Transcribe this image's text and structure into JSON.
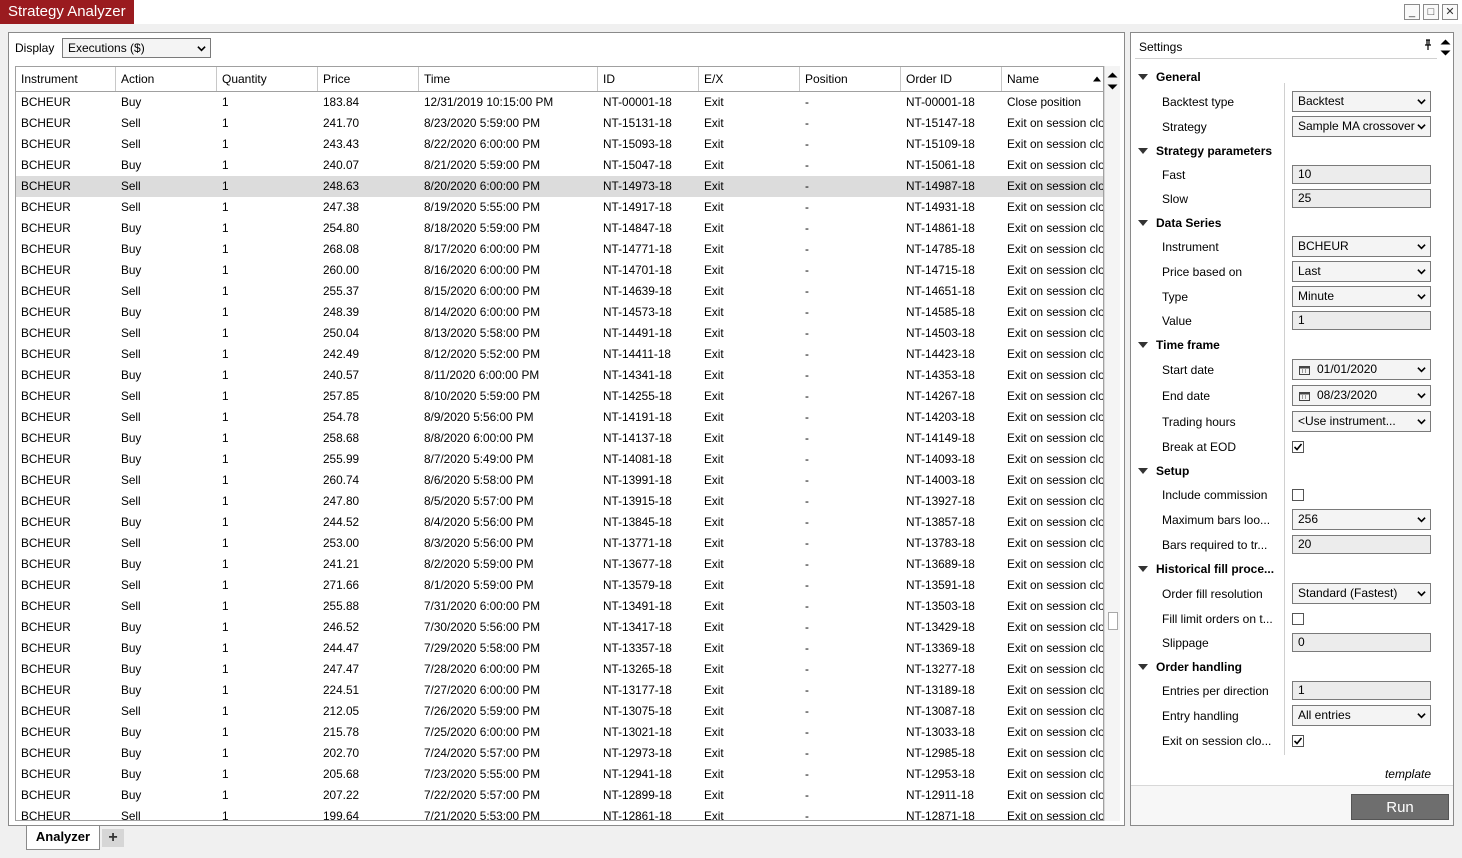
{
  "window": {
    "title": "Strategy Analyzer",
    "accent_color": "#9a1b1f",
    "buttons": {
      "minimize": "_",
      "maximize": "□",
      "close": "✕"
    }
  },
  "display": {
    "label": "Display",
    "selected": "Executions ($)"
  },
  "grid": {
    "columns": [
      "Instrument",
      "Action",
      "Quantity",
      "Price",
      "Time",
      "ID",
      "E/X",
      "Position",
      "Order ID",
      "Name"
    ],
    "rows": [
      [
        "BCHEUR",
        "Buy",
        "1",
        "183.84",
        "12/31/2019 10:15:00 PM",
        "NT-00001-18",
        "Exit",
        "-",
        "NT-00001-18",
        "Close position"
      ],
      [
        "BCHEUR",
        "Sell",
        "1",
        "241.70",
        "8/23/2020 5:59:00 PM",
        "NT-15131-18",
        "Exit",
        "-",
        "NT-15147-18",
        "Exit on session close"
      ],
      [
        "BCHEUR",
        "Sell",
        "1",
        "243.43",
        "8/22/2020 6:00:00 PM",
        "NT-15093-18",
        "Exit",
        "-",
        "NT-15109-18",
        "Exit on session close"
      ],
      [
        "BCHEUR",
        "Buy",
        "1",
        "240.07",
        "8/21/2020 5:59:00 PM",
        "NT-15047-18",
        "Exit",
        "-",
        "NT-15061-18",
        "Exit on session close"
      ],
      [
        "BCHEUR",
        "Sell",
        "1",
        "248.63",
        "8/20/2020 6:00:00 PM",
        "NT-14973-18",
        "Exit",
        "-",
        "NT-14987-18",
        "Exit on session close"
      ],
      [
        "BCHEUR",
        "Sell",
        "1",
        "247.38",
        "8/19/2020 5:55:00 PM",
        "NT-14917-18",
        "Exit",
        "-",
        "NT-14931-18",
        "Exit on session close"
      ],
      [
        "BCHEUR",
        "Buy",
        "1",
        "254.80",
        "8/18/2020 5:59:00 PM",
        "NT-14847-18",
        "Exit",
        "-",
        "NT-14861-18",
        "Exit on session close"
      ],
      [
        "BCHEUR",
        "Buy",
        "1",
        "268.08",
        "8/17/2020 6:00:00 PM",
        "NT-14771-18",
        "Exit",
        "-",
        "NT-14785-18",
        "Exit on session close"
      ],
      [
        "BCHEUR",
        "Buy",
        "1",
        "260.00",
        "8/16/2020 6:00:00 PM",
        "NT-14701-18",
        "Exit",
        "-",
        "NT-14715-18",
        "Exit on session close"
      ],
      [
        "BCHEUR",
        "Sell",
        "1",
        "255.37",
        "8/15/2020 6:00:00 PM",
        "NT-14639-18",
        "Exit",
        "-",
        "NT-14651-18",
        "Exit on session close"
      ],
      [
        "BCHEUR",
        "Buy",
        "1",
        "248.39",
        "8/14/2020 6:00:00 PM",
        "NT-14573-18",
        "Exit",
        "-",
        "NT-14585-18",
        "Exit on session close"
      ],
      [
        "BCHEUR",
        "Sell",
        "1",
        "250.04",
        "8/13/2020 5:58:00 PM",
        "NT-14491-18",
        "Exit",
        "-",
        "NT-14503-18",
        "Exit on session close"
      ],
      [
        "BCHEUR",
        "Sell",
        "1",
        "242.49",
        "8/12/2020 5:52:00 PM",
        "NT-14411-18",
        "Exit",
        "-",
        "NT-14423-18",
        "Exit on session close"
      ],
      [
        "BCHEUR",
        "Buy",
        "1",
        "240.57",
        "8/11/2020 6:00:00 PM",
        "NT-14341-18",
        "Exit",
        "-",
        "NT-14353-18",
        "Exit on session close"
      ],
      [
        "BCHEUR",
        "Sell",
        "1",
        "257.85",
        "8/10/2020 5:59:00 PM",
        "NT-14255-18",
        "Exit",
        "-",
        "NT-14267-18",
        "Exit on session close"
      ],
      [
        "BCHEUR",
        "Sell",
        "1",
        "254.78",
        "8/9/2020 5:56:00 PM",
        "NT-14191-18",
        "Exit",
        "-",
        "NT-14203-18",
        "Exit on session close"
      ],
      [
        "BCHEUR",
        "Buy",
        "1",
        "258.68",
        "8/8/2020 6:00:00 PM",
        "NT-14137-18",
        "Exit",
        "-",
        "NT-14149-18",
        "Exit on session close"
      ],
      [
        "BCHEUR",
        "Buy",
        "1",
        "255.99",
        "8/7/2020 5:49:00 PM",
        "NT-14081-18",
        "Exit",
        "-",
        "NT-14093-18",
        "Exit on session close"
      ],
      [
        "BCHEUR",
        "Sell",
        "1",
        "260.74",
        "8/6/2020 5:58:00 PM",
        "NT-13991-18",
        "Exit",
        "-",
        "NT-14003-18",
        "Exit on session close"
      ],
      [
        "BCHEUR",
        "Sell",
        "1",
        "247.80",
        "8/5/2020 5:57:00 PM",
        "NT-13915-18",
        "Exit",
        "-",
        "NT-13927-18",
        "Exit on session close"
      ],
      [
        "BCHEUR",
        "Buy",
        "1",
        "244.52",
        "8/4/2020 5:56:00 PM",
        "NT-13845-18",
        "Exit",
        "-",
        "NT-13857-18",
        "Exit on session close"
      ],
      [
        "BCHEUR",
        "Sell",
        "1",
        "253.00",
        "8/3/2020 5:56:00 PM",
        "NT-13771-18",
        "Exit",
        "-",
        "NT-13783-18",
        "Exit on session close"
      ],
      [
        "BCHEUR",
        "Buy",
        "1",
        "241.21",
        "8/2/2020 5:59:00 PM",
        "NT-13677-18",
        "Exit",
        "-",
        "NT-13689-18",
        "Exit on session close"
      ],
      [
        "BCHEUR",
        "Sell",
        "1",
        "271.66",
        "8/1/2020 5:59:00 PM",
        "NT-13579-18",
        "Exit",
        "-",
        "NT-13591-18",
        "Exit on session close"
      ],
      [
        "BCHEUR",
        "Sell",
        "1",
        "255.88",
        "7/31/2020 6:00:00 PM",
        "NT-13491-18",
        "Exit",
        "-",
        "NT-13503-18",
        "Exit on session close"
      ],
      [
        "BCHEUR",
        "Buy",
        "1",
        "246.52",
        "7/30/2020 5:56:00 PM",
        "NT-13417-18",
        "Exit",
        "-",
        "NT-13429-18",
        "Exit on session close"
      ],
      [
        "BCHEUR",
        "Buy",
        "1",
        "244.47",
        "7/29/2020 5:58:00 PM",
        "NT-13357-18",
        "Exit",
        "-",
        "NT-13369-18",
        "Exit on session close"
      ],
      [
        "BCHEUR",
        "Buy",
        "1",
        "247.47",
        "7/28/2020 6:00:00 PM",
        "NT-13265-18",
        "Exit",
        "-",
        "NT-13277-18",
        "Exit on session close"
      ],
      [
        "BCHEUR",
        "Buy",
        "1",
        "224.51",
        "7/27/2020 6:00:00 PM",
        "NT-13177-18",
        "Exit",
        "-",
        "NT-13189-18",
        "Exit on session close"
      ],
      [
        "BCHEUR",
        "Sell",
        "1",
        "212.05",
        "7/26/2020 5:59:00 PM",
        "NT-13075-18",
        "Exit",
        "-",
        "NT-13087-18",
        "Exit on session close"
      ],
      [
        "BCHEUR",
        "Buy",
        "1",
        "215.78",
        "7/25/2020 6:00:00 PM",
        "NT-13021-18",
        "Exit",
        "-",
        "NT-13033-18",
        "Exit on session close"
      ],
      [
        "BCHEUR",
        "Buy",
        "1",
        "202.70",
        "7/24/2020 5:57:00 PM",
        "NT-12973-18",
        "Exit",
        "-",
        "NT-12985-18",
        "Exit on session close"
      ],
      [
        "BCHEUR",
        "Buy",
        "1",
        "205.68",
        "7/23/2020 5:55:00 PM",
        "NT-12941-18",
        "Exit",
        "-",
        "NT-12953-18",
        "Exit on session close"
      ],
      [
        "BCHEUR",
        "Buy",
        "1",
        "207.22",
        "7/22/2020 5:57:00 PM",
        "NT-12899-18",
        "Exit",
        "-",
        "NT-12911-18",
        "Exit on session close"
      ],
      [
        "BCHEUR",
        "Sell",
        "1",
        "199.64",
        "7/21/2020 5:53:00 PM",
        "NT-12861-18",
        "Exit",
        "-",
        "NT-12871-18",
        "Exit on session close"
      ]
    ],
    "selected_row": 4
  },
  "settings": {
    "title": "Settings",
    "groups": {
      "general": "General",
      "strategy_parameters": "Strategy parameters",
      "data_series": "Data Series",
      "time_frame": "Time frame",
      "setup": "Setup",
      "historical_fill": "Historical fill proce...",
      "order_handling": "Order handling"
    },
    "general": {
      "backtest_type_label": "Backtest type",
      "backtest_type": "Backtest",
      "strategy_label": "Strategy",
      "strategy": "Sample MA crossover"
    },
    "strategy_parameters": {
      "fast_label": "Fast",
      "fast": "10",
      "slow_label": "Slow",
      "slow": "25"
    },
    "data_series": {
      "instrument_label": "Instrument",
      "instrument": "BCHEUR",
      "price_based_on_label": "Price based on",
      "price_based_on": "Last",
      "type_label": "Type",
      "type": "Minute",
      "value_label": "Value",
      "value": "1"
    },
    "time_frame": {
      "start_date_label": "Start date",
      "start_date": "01/01/2020",
      "end_date_label": "End date",
      "end_date": "08/23/2020",
      "trading_hours_label": "Trading hours",
      "trading_hours": "<Use instrument...",
      "break_at_eod_label": "Break at EOD",
      "break_at_eod": true
    },
    "setup": {
      "include_commission_label": "Include commission",
      "include_commission": false,
      "max_bars_label": "Maximum bars loo...",
      "max_bars": "256",
      "bars_required_label": "Bars required to tr...",
      "bars_required": "20"
    },
    "historical_fill": {
      "order_fill_resolution_label": "Order fill resolution",
      "order_fill_resolution": "Standard (Fastest)",
      "fill_limit_label": "Fill limit orders on t...",
      "fill_limit": false,
      "slippage_label": "Slippage",
      "slippage": "0"
    },
    "order_handling": {
      "entries_per_direction_label": "Entries per direction",
      "entries_per_direction": "1",
      "entry_handling_label": "Entry handling",
      "entry_handling": "All entries",
      "exit_on_session_close_label": "Exit on session clo...",
      "exit_on_session_close": true
    },
    "template_link": "template",
    "run_button": "Run"
  },
  "tabs": {
    "analyzer": "Analyzer",
    "add": "+"
  },
  "icons": {
    "sort": "sort-ascending-icon",
    "pin": "pin-icon",
    "calendar": "calendar-icon",
    "caret": "caret-down-icon",
    "checkbox": "check-icon"
  }
}
